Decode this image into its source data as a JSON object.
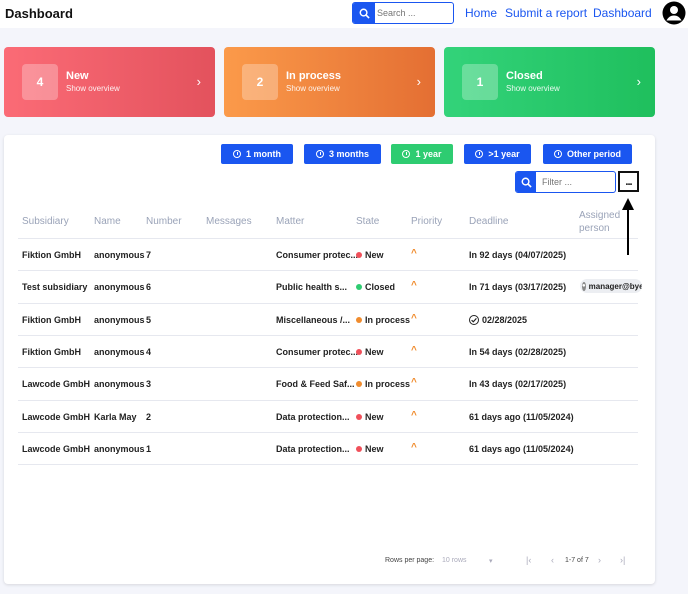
{
  "header": {
    "title": "Dashboard",
    "search_placeholder": "Search ...",
    "nav": [
      "Home",
      "Submit a report",
      "Dashboard"
    ]
  },
  "cards": [
    {
      "count": "4",
      "label": "New",
      "sub": "Show overview"
    },
    {
      "count": "2",
      "label": "In process",
      "sub": "Show overview"
    },
    {
      "count": "1",
      "label": "Closed",
      "sub": "Show overview"
    }
  ],
  "periods": [
    "1 month",
    "3 months",
    "1 year",
    ">1 year",
    "Other period"
  ],
  "active_period": "1 year",
  "filter_placeholder": "Filter ...",
  "more_label": "...",
  "columns": [
    "Subsidiary",
    "Name",
    "Number",
    "Messages",
    "Matter",
    "State",
    "Priority",
    "Deadline",
    "Assigned person"
  ],
  "rows": [
    {
      "subsidiary": "Fiktion GmbH",
      "name": "anonymous",
      "number": "7",
      "messages": "",
      "matter": "Consumer protec...",
      "state": "New",
      "priority": "^",
      "deadline": "In 92 days (04/07/2025)",
      "assigned": ""
    },
    {
      "subsidiary": "Test subsidiary",
      "name": "anonymous",
      "number": "6",
      "messages": "",
      "matter": "Public health s...",
      "state": "Closed",
      "priority": "^",
      "deadline": "In 71 days (03/17/2025)",
      "assigned": "manager@bye"
    },
    {
      "subsidiary": "Fiktion GmbH",
      "name": "anonymous",
      "number": "5",
      "messages": "",
      "matter": "Miscellaneous /...",
      "state": "In process",
      "priority": "^",
      "deadline": "02/28/2025",
      "assigned": ""
    },
    {
      "subsidiary": "Fiktion GmbH",
      "name": "anonymous",
      "number": "4",
      "messages": "",
      "matter": "Consumer protec...",
      "state": "New",
      "priority": "^",
      "deadline": "In 54 days (02/28/2025)",
      "assigned": ""
    },
    {
      "subsidiary": "Lawcode GmbH",
      "name": "anonymous",
      "number": "3",
      "messages": "",
      "matter": "Food & Feed Saf...",
      "state": "In process",
      "priority": "^",
      "deadline": "In 43 days (02/17/2025)",
      "assigned": ""
    },
    {
      "subsidiary": "Lawcode GmbH",
      "name": "Karla May",
      "number": "2",
      "messages": "",
      "matter": "Data protection...",
      "state": "New",
      "priority": "^",
      "deadline": "61 days ago (11/05/2024)",
      "assigned": ""
    },
    {
      "subsidiary": "Lawcode GmbH",
      "name": "anonymous",
      "number": "1",
      "messages": "",
      "matter": "Data protection...",
      "state": "New",
      "priority": "^",
      "deadline": "61 days ago (11/05/2024)",
      "assigned": ""
    }
  ],
  "state_colors": {
    "New": "#f0505a",
    "Closed": "#2ecc71",
    "In process": "#f08c2e"
  },
  "pagination": {
    "rows_per_page_label": "Rows per page:",
    "rows_per_page_value": "10 rows",
    "range": "1-7 of 7"
  }
}
